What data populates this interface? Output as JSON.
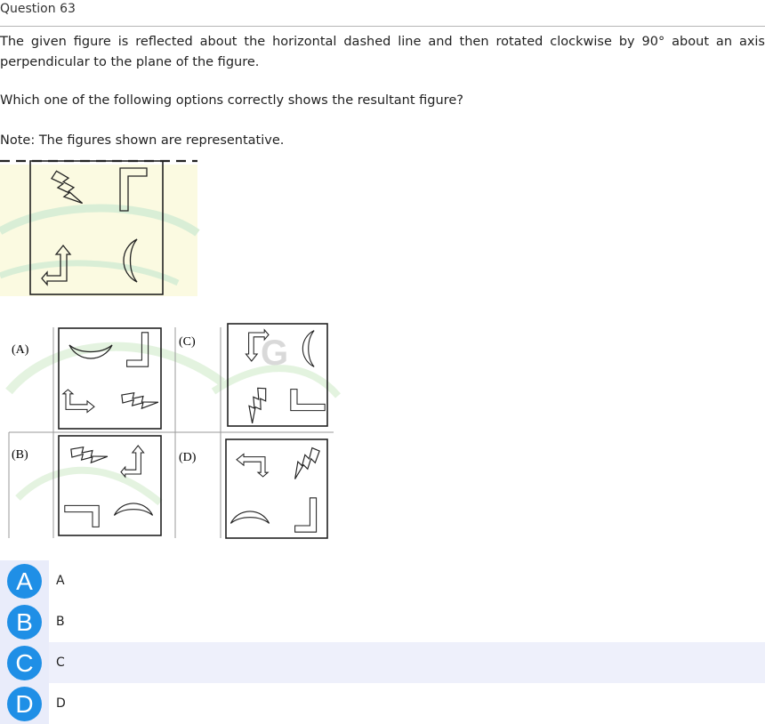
{
  "question": {
    "title": "Question 63",
    "text": "The given figure is reflected about the horizontal dashed line and then rotated clockwise by 90° about an axis perpendicular to the plane of the figure.",
    "prompt": "Which one of the following options correctly shows the resultant figure?",
    "note": "Note: The figures shown are representative."
  },
  "figure_labels": {
    "a": "(A)",
    "b": "(B)",
    "c": "(C)",
    "d": "(D)"
  },
  "watermark_text": "G",
  "options": [
    {
      "letter": "A",
      "text": "A",
      "highlighted": false
    },
    {
      "letter": "B",
      "text": "B",
      "highlighted": false
    },
    {
      "letter": "C",
      "text": "C",
      "highlighted": true
    },
    {
      "letter": "D",
      "text": "D",
      "highlighted": false
    }
  ],
  "colors": {
    "badge": "#1f8fe6",
    "highlight_row": "#eef0fb",
    "watermark_green": "#cfe9c8",
    "watermark_yellow": "#fbfadc"
  },
  "icons": [
    "lightning-bolt-icon",
    "l-shape-icon",
    "hook-arrow-icon",
    "crescent-icon"
  ]
}
